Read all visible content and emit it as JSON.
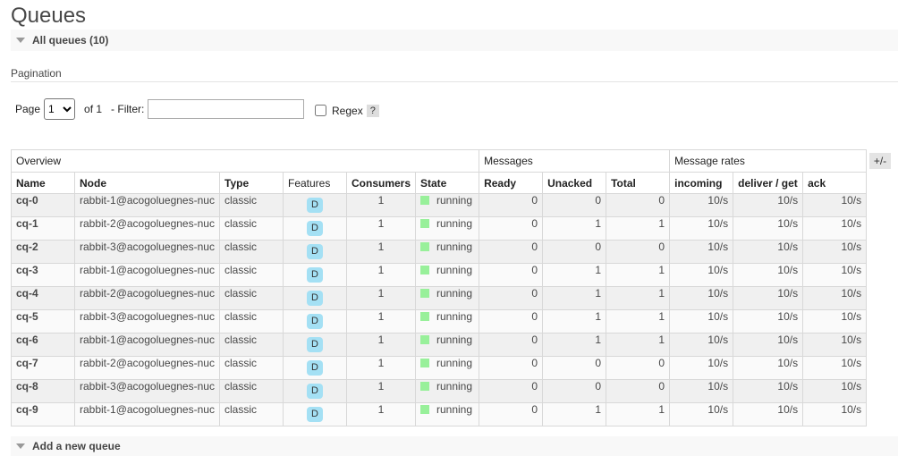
{
  "page": {
    "title": "Queues"
  },
  "all_queues": {
    "label": "All queues (10)"
  },
  "pagination": {
    "heading": "Pagination",
    "page_label": "Page",
    "page_value": "1",
    "of_label": "of 1",
    "filter_label": "- Filter:",
    "filter_value": "",
    "regex_label": "Regex",
    "help_label": "?"
  },
  "table": {
    "groups": [
      "Overview",
      "Messages",
      "Message rates"
    ],
    "toggle_label": "+/-",
    "columns": [
      "Name",
      "Node",
      "Type",
      "Features",
      "Consumers",
      "State",
      "Ready",
      "Unacked",
      "Total",
      "incoming",
      "deliver / get",
      "ack"
    ],
    "rows": [
      {
        "name": "cq-0",
        "node": "rabbit-1@acogoluegnes-nuc",
        "type": "classic",
        "feature": "D",
        "consumers": "1",
        "state": "running",
        "ready": "0",
        "unacked": "0",
        "total": "0",
        "incoming": "10/s",
        "deliver": "10/s",
        "ack": "10/s"
      },
      {
        "name": "cq-1",
        "node": "rabbit-2@acogoluegnes-nuc",
        "type": "classic",
        "feature": "D",
        "consumers": "1",
        "state": "running",
        "ready": "0",
        "unacked": "1",
        "total": "1",
        "incoming": "10/s",
        "deliver": "10/s",
        "ack": "10/s"
      },
      {
        "name": "cq-2",
        "node": "rabbit-3@acogoluegnes-nuc",
        "type": "classic",
        "feature": "D",
        "consumers": "1",
        "state": "running",
        "ready": "0",
        "unacked": "0",
        "total": "0",
        "incoming": "10/s",
        "deliver": "10/s",
        "ack": "10/s"
      },
      {
        "name": "cq-3",
        "node": "rabbit-1@acogoluegnes-nuc",
        "type": "classic",
        "feature": "D",
        "consumers": "1",
        "state": "running",
        "ready": "0",
        "unacked": "1",
        "total": "1",
        "incoming": "10/s",
        "deliver": "10/s",
        "ack": "10/s"
      },
      {
        "name": "cq-4",
        "node": "rabbit-2@acogoluegnes-nuc",
        "type": "classic",
        "feature": "D",
        "consumers": "1",
        "state": "running",
        "ready": "0",
        "unacked": "1",
        "total": "1",
        "incoming": "10/s",
        "deliver": "10/s",
        "ack": "10/s"
      },
      {
        "name": "cq-5",
        "node": "rabbit-3@acogoluegnes-nuc",
        "type": "classic",
        "feature": "D",
        "consumers": "1",
        "state": "running",
        "ready": "0",
        "unacked": "1",
        "total": "1",
        "incoming": "10/s",
        "deliver": "10/s",
        "ack": "10/s"
      },
      {
        "name": "cq-6",
        "node": "rabbit-1@acogoluegnes-nuc",
        "type": "classic",
        "feature": "D",
        "consumers": "1",
        "state": "running",
        "ready": "0",
        "unacked": "1",
        "total": "1",
        "incoming": "10/s",
        "deliver": "10/s",
        "ack": "10/s"
      },
      {
        "name": "cq-7",
        "node": "rabbit-2@acogoluegnes-nuc",
        "type": "classic",
        "feature": "D",
        "consumers": "1",
        "state": "running",
        "ready": "0",
        "unacked": "0",
        "total": "0",
        "incoming": "10/s",
        "deliver": "10/s",
        "ack": "10/s"
      },
      {
        "name": "cq-8",
        "node": "rabbit-3@acogoluegnes-nuc",
        "type": "classic",
        "feature": "D",
        "consumers": "1",
        "state": "running",
        "ready": "0",
        "unacked": "0",
        "total": "0",
        "incoming": "10/s",
        "deliver": "10/s",
        "ack": "10/s"
      },
      {
        "name": "cq-9",
        "node": "rabbit-1@acogoluegnes-nuc",
        "type": "classic",
        "feature": "D",
        "consumers": "1",
        "state": "running",
        "ready": "0",
        "unacked": "1",
        "total": "1",
        "incoming": "10/s",
        "deliver": "10/s",
        "ack": "10/s"
      }
    ]
  },
  "add_queue": {
    "label": "Add a new queue"
  },
  "colors": {
    "running": "#98f09a",
    "feature_badge": "#a4e0f4"
  },
  "icons": {
    "section_toggle": "triangle-down-icon",
    "state": "status-square-icon"
  }
}
